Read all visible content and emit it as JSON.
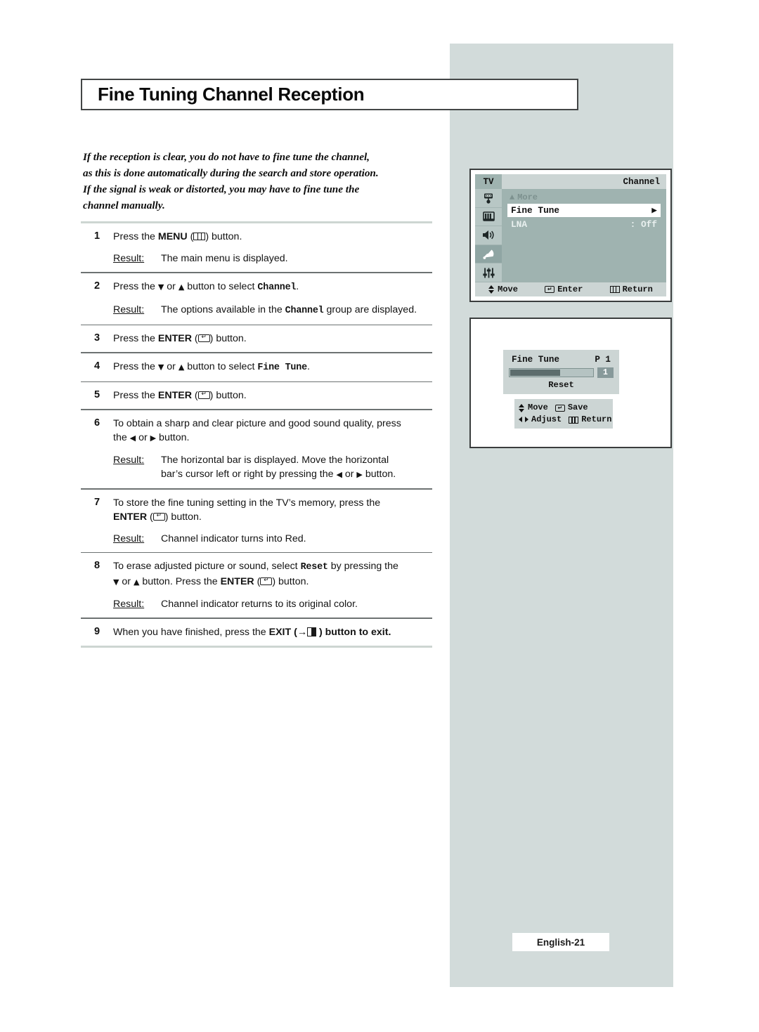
{
  "page": {
    "title": "Fine Tuning Channel Reception",
    "footer_label": "English-21",
    "accent_panel_color": "#d2dbda",
    "rule_color": "#6d7272"
  },
  "intro": {
    "lines": [
      "If the reception is clear, you do not have to fine tune the channel,",
      "as this is done automatically during the search and store operation.",
      "If the signal is weak or distorted, you may have to fine tune the",
      "channel manually."
    ]
  },
  "steps": [
    {
      "num": "1",
      "text_before": "Press the ",
      "bold": "MENU",
      "icon": "menu-icon",
      "text_after": ") button.",
      "result_label": "Result:",
      "result_text": "The main menu is displayed."
    },
    {
      "num": "2",
      "result_label": "Result:",
      "result_text_1": "The options available in the ",
      "result_mono": "Channel",
      "result_text_2": " group are displayed."
    },
    {
      "num": "3",
      "bold": "ENTER",
      "icon": "enter-icon"
    },
    {
      "num": "4",
      "mono": "Fine Tune"
    },
    {
      "num": "5",
      "bold": "ENTER",
      "icon": "enter-icon"
    },
    {
      "num": "6",
      "line_1": "To obtain a sharp and clear picture and good sound quality, press",
      "line_2_a": "the ",
      "line_2_b": " or ",
      "line_2_c": " button.",
      "result_label": "Result:",
      "result_line_1": "The horizontal bar is displayed. Move the horizontal",
      "result_line_2_a": "bar’s cursor left or right by pressing the ",
      "result_line_2_b": " or ",
      "result_line_2_c": " button."
    },
    {
      "num": "7",
      "line_1": "To store the fine tuning setting in the TV’s memory, press the",
      "bold": "ENTER",
      "text_after": ") button.",
      "result_label": "Result:",
      "result_text": "Channel indicator turns into Red."
    },
    {
      "num": "8",
      "line_1_a": "To erase adjusted picture or sound, select ",
      "line_1_mono": "Reset",
      "line_1_b": " by pressing the",
      "line_2_b": " or ",
      "line_2_c": " button. Press the ",
      "line_2_bold": "ENTER",
      "line_2_d": ") button.",
      "result_label": "Result:",
      "result_text": "Channel indicator returns to its original color."
    },
    {
      "num": "9",
      "text_a": "When you have finished, press the ",
      "bold": "EXIT",
      "text_b": " ) button to exit."
    }
  ],
  "common": {
    "press_the": "Press the ",
    "or": " or ",
    "button_period": " button to select ",
    "button_dot": " button.",
    "paren_open": " (",
    "paren_close": ")"
  },
  "osd_menu": {
    "tv_tab": "TV",
    "title": "Channel",
    "sidebar_icons": [
      "remote-icon",
      "picture-icon",
      "sound-icon",
      "satellite-dish-icon",
      "setup-sliders-icon"
    ],
    "selected_sidebar_index": 3,
    "rows": [
      {
        "label": "More",
        "type": "more",
        "marker": "▲"
      },
      {
        "label": "Fine Tune",
        "type": "selected",
        "marker": "▶"
      },
      {
        "label": "LNA",
        "type": "plain",
        "value": ": Off"
      }
    ],
    "hints": [
      {
        "icon": "up-down-arrows-icon",
        "label": "Move"
      },
      {
        "icon": "enter-icon",
        "label": "Enter"
      },
      {
        "icon": "menu-icon",
        "label": "Return"
      }
    ]
  },
  "osd_finetune": {
    "label": "Fine Tune",
    "channel": "P 1",
    "bar_percent": 60,
    "value": "1",
    "reset_label": "Reset",
    "hints": [
      {
        "icon": "up-down-arrows-icon",
        "label": "Move"
      },
      {
        "icon": "enter-icon",
        "label": "Save"
      },
      {
        "icon": "left-right-arrows-icon",
        "label": "Adjust"
      },
      {
        "icon": "menu-icon",
        "label": "Return"
      }
    ]
  }
}
